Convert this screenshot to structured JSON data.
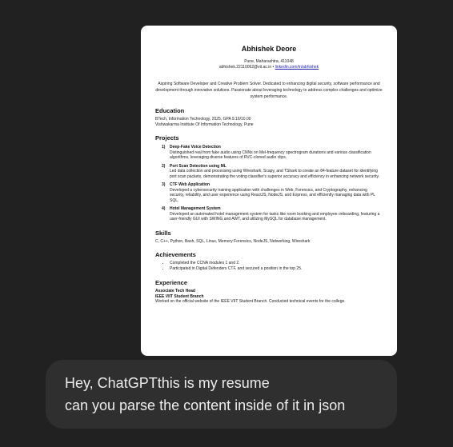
{
  "resume": {
    "name": "Abhishek Deore",
    "location": "Pune, Maharashtra, 411048",
    "email": "abhishek.22110062@vit.ac.in",
    "separator": " • ",
    "linkedin": "linkedin.com/in/abhishek",
    "summary": "Aspiring Software Developer and Creative Problem Solver. Dedicated to enhancing digital security, software performance and development through innovative solutions. Passionate about leveraging technology to address complex challenges and optimize system performance.",
    "education": {
      "heading": "Education",
      "degree": "BTech, Information Technology, 2025, GPA 9.16/10.00",
      "institute": "Vishwakarma Institute Of Information Technology, Pune"
    },
    "projects": {
      "heading": "Projects",
      "items": [
        {
          "num": "1)",
          "title": "Deep-Fake Voice Detection",
          "desc": "Distinguished real from fake audio using CNNs on Mel-frequency spectrogram durations and various classification algorithms, leveraging diverse features of RVC-cloned audio clips."
        },
        {
          "num": "2)",
          "title": "Port Scan Detection using ML",
          "desc": "Led data collection and processing using Wireshark, Scapy, and TShark to create an 84-feature dataset for identifying port scan packets, demonstrating the voting classifier's superior accuracy and efficiency in enhancing network security."
        },
        {
          "num": "3)",
          "title": "CTF Web Application",
          "desc": "Developed a cybersecurity training application with challenges in Web, Forensics, and Cryptography, enhancing security, reliability, and user experience using ReactJS, NodeJS, and Express, and efficiently managing data with PL SQL."
        },
        {
          "num": "4)",
          "title": "Hotel Management System",
          "desc": "Developed an automated hotel management system for tasks like room booking and employee onboarding, featuring a user-friendly GUI with SWING and AWT, and utilizing MySQL for database management."
        }
      ]
    },
    "skills": {
      "heading": "Skills",
      "list": "C, C++, Python, Bash, SQL, Linux, Memory Forensics, NodeJS, Networking, Wireshark"
    },
    "achievements": {
      "heading": "Achievements",
      "items": [
        "Completed the CCNA modules 1 and 2.",
        "Participated in Digital Defenders CTF, and secured a position in the top 25."
      ]
    },
    "experience": {
      "heading": "Experience",
      "role": "Associate Tech Head",
      "org": "IEEE VIIT Student Branch",
      "desc": "Worked on the official website of the IEEE VIIT Student Branch. Conducted technical events for the college."
    }
  },
  "message": {
    "line1": "Hey, ChatGPTthis is my resume",
    "line2": "can you parse the content inside of it in json"
  }
}
